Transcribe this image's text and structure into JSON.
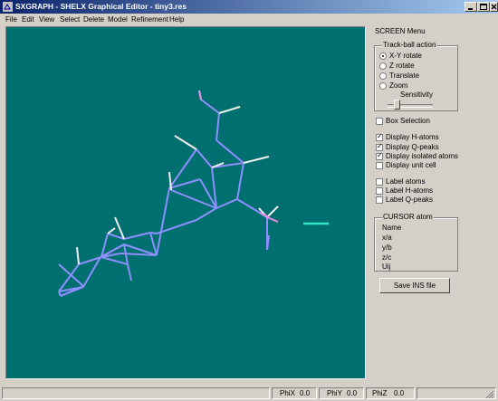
{
  "titlebar": {
    "title": "SXGRAPH - SHELX Graphical Editor - tiny3.res"
  },
  "menubar": {
    "items": [
      "File",
      "Edit",
      "View",
      "Select",
      "Delete",
      "Model",
      "Refinement",
      "Help"
    ]
  },
  "panel": {
    "screen_menu_title": "SCREEN Menu",
    "trackball": {
      "title": "Track-ball action",
      "options": [
        "X-Y rotate",
        "Z rotate",
        "Translate",
        "Zoom"
      ],
      "selected": "X-Y rotate",
      "sensitivity_label": "Sensitivity",
      "sensitivity_level": 0.2
    },
    "box_selection": {
      "label": "Box Selection",
      "checked": false
    },
    "display_options": [
      {
        "label": "Display H-atoms",
        "checked": true
      },
      {
        "label": "Display Q-peaks",
        "checked": true
      },
      {
        "label": "Display isolated atoms",
        "checked": true
      },
      {
        "label": "Display unit cell",
        "checked": false
      }
    ],
    "label_options": [
      {
        "label": "Label atoms",
        "checked": false
      },
      {
        "label": "Label H-atoms",
        "checked": false
      },
      {
        "label": "Label Q-peaks",
        "checked": false
      }
    ],
    "cursor_atom": {
      "title": "CURSOR atom",
      "fields": [
        "Name",
        "x/a",
        "y/b",
        "z/c",
        "Uij"
      ]
    },
    "save_button": "Save INS file"
  },
  "statusbar": {
    "phix_label": "PhiX",
    "phix_value": "0.0",
    "phiy_label": "PhiY",
    "phiy_value": "0.0",
    "phiz_label": "PhiZ",
    "phiz_value": "0.0"
  },
  "colors": {
    "viewport_bg": "#006f6f",
    "bond": "#8f8fff",
    "hydrogen": "#f0f0f0",
    "oxygen": "#e58ee5",
    "qpeak": "#33e6c8"
  }
}
